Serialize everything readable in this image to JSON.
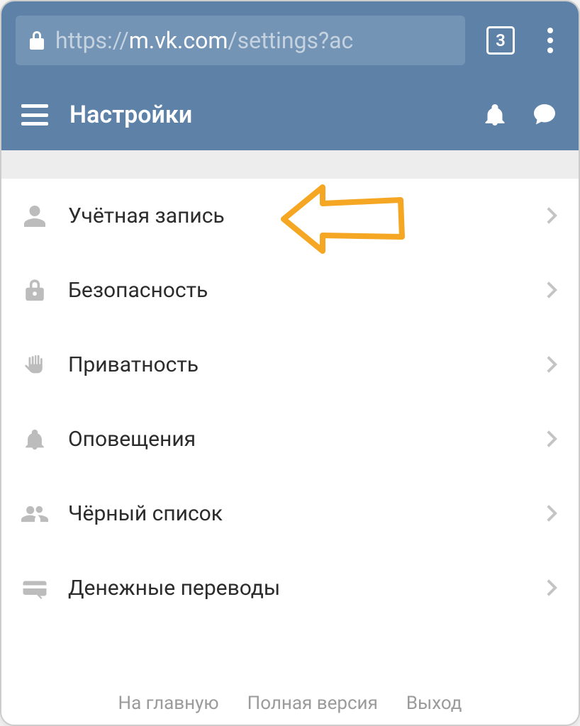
{
  "browser": {
    "url_prefix": "https://",
    "url_host": "m.vk.com",
    "url_path": "/settings?ac",
    "tab_count": "3"
  },
  "header": {
    "title": "Настройки"
  },
  "settings": {
    "items": [
      {
        "icon": "person-icon",
        "label": "Учётная запись"
      },
      {
        "icon": "lock-icon",
        "label": "Безопасность"
      },
      {
        "icon": "hand-icon",
        "label": "Приватность"
      },
      {
        "icon": "bell-icon",
        "label": "Оповещения"
      },
      {
        "icon": "people-icon",
        "label": "Чёрный список"
      },
      {
        "icon": "card-icon",
        "label": "Денежные переводы"
      }
    ]
  },
  "footer": {
    "home": "На главную",
    "full_version": "Полная версия",
    "logout": "Выход"
  }
}
